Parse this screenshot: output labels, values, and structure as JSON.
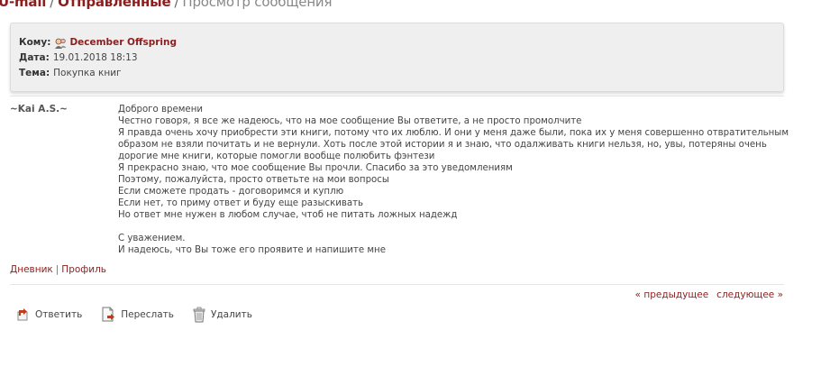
{
  "breadcrumb": {
    "root": "U-mail",
    "section": "Отправленные",
    "current": "Просмотр сообщения"
  },
  "header": {
    "to_label": "Кому:",
    "to_value": "December Offspring",
    "date_label": "Дата:",
    "date_value": "19.01.2018 18:13",
    "subject_label": "Тема:",
    "subject_value": "Покупка книг"
  },
  "message": {
    "author": "~Kai A.S.~",
    "lines": [
      "Доброго времени",
      "Честно говоря, я все же надеюсь, что на мое сообщение Вы ответите, а не просто промолчите",
      "Я правда очень хочу приобрести эти книги, потому что их люблю. И они у меня даже были, пока их у меня совершенно отвратительным",
      "образом не взяли почитать и не вернули. Хоть после этой истории я и знаю, что одалживать книги нельзя, но, увы, потеряны очень",
      "дорогие мне книги, которые помогли вообще полюбить фэнтези",
      "Я прекрасно знаю, что мое сообщение Вы прочли. Спасибо за это уведомлениям",
      "Поэтому, пожалуйста, просто ответьте на мои вопросы",
      "Если сможете продать - договоримся и куплю",
      "Если нет, то приму ответ и буду еще разыскивать",
      "Но ответ мне нужен в любом случае, чтоб не питать ложных надежд",
      "",
      "С уважением.",
      "И надеюсь, что Вы тоже его проявите и напишите мне"
    ]
  },
  "author_links": {
    "diary": "Дневник",
    "separator": "|",
    "profile": "Профиль"
  },
  "pager": {
    "prev": "« предыдущее",
    "next": "следующее »"
  },
  "actions": {
    "reply": "Ответить",
    "forward": "Переслать",
    "delete": "Удалить"
  },
  "colors": {
    "accent": "#8b1e1e",
    "header_bg": "#efefef",
    "text": "#444444"
  },
  "icons": {
    "recipient": "user-icon",
    "reply": "reply-icon",
    "forward": "forward-icon",
    "delete": "trash-icon"
  }
}
